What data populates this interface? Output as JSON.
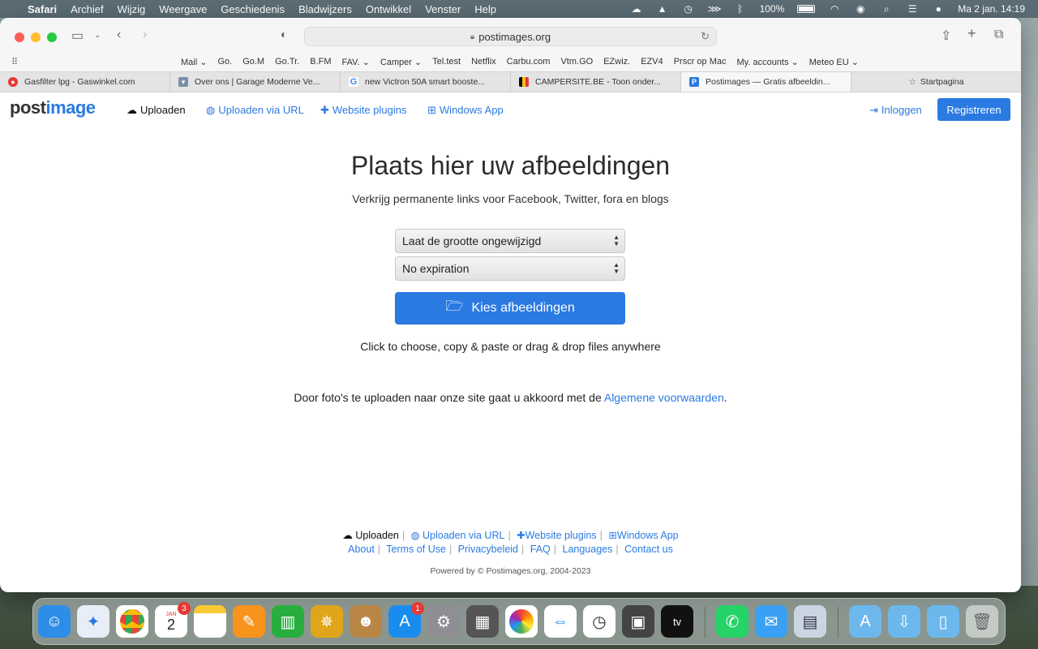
{
  "menubar": {
    "app": "Safari",
    "items": [
      "Archief",
      "Wijzig",
      "Weergave",
      "Geschiedenis",
      "Bladwijzers",
      "Ontwikkel",
      "Venster",
      "Help"
    ],
    "battery": "100%",
    "datetime": "Ma 2 jan.  14:19"
  },
  "browser": {
    "url": "postimages.org",
    "bookmarks": [
      "Mail ⌄",
      "Go.",
      "Go.M",
      "Go.Tr.",
      "B.FM",
      "FAV. ⌄",
      "Camper ⌄",
      "Tel.test",
      "Netflix",
      "Carbu.com",
      "Vtm.GO",
      "EZwiz.",
      "EZV4",
      "Prscr op Mac",
      "My. accounts ⌄",
      "Meteo EU ⌄"
    ],
    "tabs": [
      {
        "title": "Gasfilter lpg - Gaswinkel.com",
        "color": "#e53935"
      },
      {
        "title": "Over ons | Garage Moderne Ve...",
        "color": "#7a8fa6"
      },
      {
        "title": "new Victron 50A smart booste...",
        "color": "#4285f4"
      },
      {
        "title": "CAMPERSITE.BE - Toon onder...",
        "color": "#f4c20d"
      },
      {
        "title": "Postimages — Gratis afbeeldin...",
        "color": "#2a7ae2"
      }
    ],
    "start_tab": "Startpagina"
  },
  "site": {
    "logo_part1": "post",
    "logo_part2": "image",
    "nav": {
      "upload": "Uploaden",
      "upload_url": "Uploaden via URL",
      "plugins": "Website plugins",
      "windows": "Windows App",
      "login": "Inloggen",
      "register": "Registreren"
    },
    "headline": "Plaats hier uw afbeeldingen",
    "subline": "Verkrijg permanente links voor Facebook, Twitter, fora en blogs",
    "resize_select": "Laat de grootte ongewijzigd",
    "expiration_select": "No expiration",
    "choose_button": "Kies afbeeldingen",
    "drop_hint": "Click to choose, copy & paste or drag & drop files anywhere",
    "terms_text": "Door foto's te uploaden naar onze site gaat u akkoord met de ",
    "terms_link": "Algemene voorwaarden",
    "terms_end": ".",
    "footer": {
      "upload": "Uploaden",
      "upload_url": "Uploaden via URL",
      "plugins": "Website plugins",
      "windows": "Windows App",
      "about": "About",
      "terms": "Terms of Use",
      "privacy": "Privacybeleid",
      "faq": "FAQ",
      "languages": "Languages",
      "contact": "Contact us",
      "powered": "Powered by © Postimages.org, 2004-2023"
    }
  },
  "dock": {
    "calendar_month": "JAN",
    "calendar_day": "2",
    "calendar_badge": "3",
    "appstore_badge": "1",
    "tv_label": "tv"
  }
}
